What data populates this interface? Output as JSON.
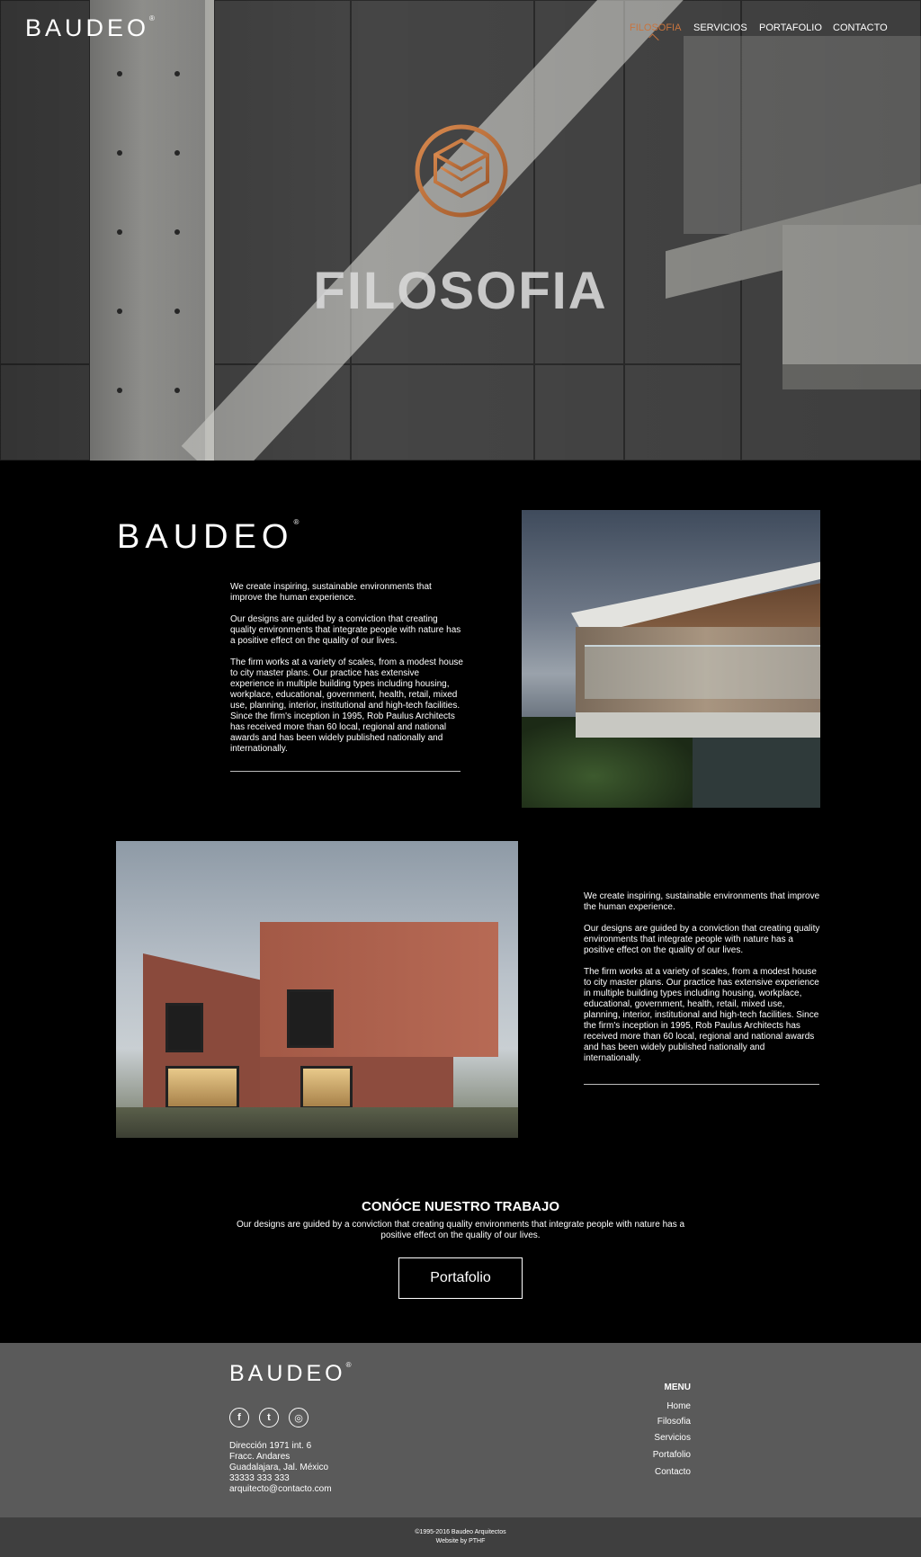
{
  "brand": {
    "name": "BAUDEO",
    "mark": "®"
  },
  "nav": {
    "items": [
      {
        "label": "FILOSOFIA",
        "active": true
      },
      {
        "label": "SERVICIOS",
        "active": false
      },
      {
        "label": "PORTAFOLIO",
        "active": false
      },
      {
        "label": "CONTACTO",
        "active": false
      }
    ]
  },
  "hero": {
    "title": "FILOSOFIA",
    "emblem": "leaf-emblem-icon"
  },
  "block1": {
    "paragraphs": [
      "We create inspiring, sustainable environments that improve the human experience.",
      "Our designs are guided by a conviction that creating quality environments that integrate people with nature has a positive effect on the quality of our lives.",
      "The firm works at a variety of scales, from a modest house to city master plans. Our practice has extensive experience in multiple building types including housing, workplace, educational, government, health, retail, mixed use, planning, interior, institutional and high-tech facilities. Since the firm's inception in 1995, Rob Paulus Architects has received more than 60 local, regional and national awards and has been widely published nationally and internationally."
    ]
  },
  "block2": {
    "paragraphs": [
      "We create inspiring, sustainable environments that improve the human experience.",
      "Our designs are guided by a conviction that creating quality environments that integrate people with nature has a positive effect on the quality of our lives.",
      "The firm works at a variety of scales, from a modest house to city master plans. Our practice has extensive experience in multiple building types including housing, workplace, educational, government, health, retail, mixed use, planning, interior, institutional and high-tech facilities. Since the firm's inception in 1995, Rob Paulus Architects has received more than 60 local, regional and national awards and has been widely published nationally and internationally."
    ]
  },
  "cta_section": {
    "title": "CONÓCE NUESTRO TRABAJO",
    "subtitle": "Our designs are guided by a conviction that creating quality environments that integrate people with nature has a positive effect on the quality of our lives.",
    "button": "Portafolio"
  },
  "footer": {
    "social": [
      {
        "icon": "facebook-icon",
        "glyph": "f"
      },
      {
        "icon": "twitter-icon",
        "glyph": "t"
      },
      {
        "icon": "instagram-icon",
        "glyph": "◎"
      }
    ],
    "address": [
      "Dirección 1971 int. 6",
      "Fracc. Andares",
      "Guadalajara, Jal. México",
      "33333 333 333",
      "arquitecto@contacto.com"
    ],
    "menu_title": "MENU",
    "menu": [
      "Home",
      "Filosofia",
      "Servicios",
      "Portafolio",
      "Contacto"
    ],
    "copyright": "©1995-2016 Baudeo Arquitectos",
    "credit": "Website by PTHF"
  },
  "colors": {
    "accent": "#c8743e",
    "footer_bg": "#5a5a5a",
    "bottom_bar": "#3f3f3f"
  }
}
